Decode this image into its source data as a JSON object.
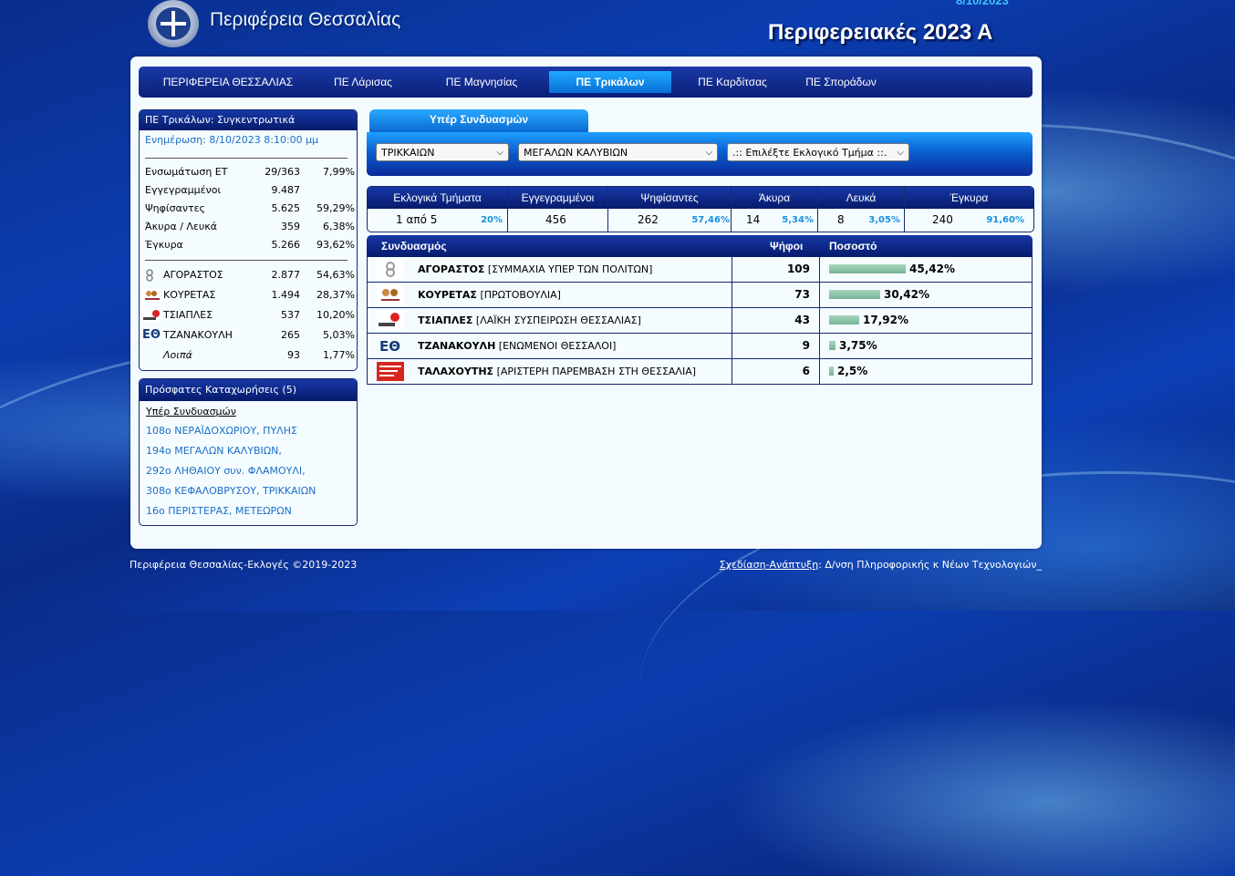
{
  "header": {
    "site_title": "Περιφέρεια Θεσσαλίας",
    "date": "8/10/2023",
    "election_title": "Περιφερειακές 2023 Α"
  },
  "nav": {
    "items": [
      {
        "label": "ΠΕΡΙΦΕΡΕΙΑ ΘΕΣΣΑΛΙΑΣ",
        "active": false
      },
      {
        "label": "ΠΕ Λάρισας",
        "active": false
      },
      {
        "label": "ΠΕ Μαγνησίας",
        "active": false
      },
      {
        "label": "ΠΕ Τρικάλων",
        "active": true
      },
      {
        "label": "ΠΕ Καρδίτσας",
        "active": false
      },
      {
        "label": "ΠΕ Σποράδων",
        "active": false
      }
    ]
  },
  "summary": {
    "title": "ΠΕ Τρικάλων: Συγκεντρωτικά",
    "updated": "Ενημέρωση: 8/10/2023 8:10:00 μμ",
    "rows": [
      {
        "label": "Ενσωμάτωση ΕΤ",
        "value": "29/363",
        "pct": "7,99%"
      },
      {
        "label": "Εγγεγραμμένοι",
        "value": "9.487",
        "pct": ""
      },
      {
        "label": "Ψηφίσαντες",
        "value": "5.625",
        "pct": "59,29%"
      },
      {
        "label": "Άκυρα / Λευκά",
        "value": "359",
        "pct": "6,38%"
      },
      {
        "label": "Έγκυρα",
        "value": "5.266",
        "pct": "93,62%"
      }
    ],
    "candidates": [
      {
        "name": "ΑΓΟΡΑΣΤΟΣ",
        "votes": "2.877",
        "pct": "54,63%",
        "logo": "agorastos-logo"
      },
      {
        "name": "ΚΟΥΡΕΤΑΣ",
        "votes": "1.494",
        "pct": "28,37%",
        "logo": "kouretas-logo"
      },
      {
        "name": "ΤΣΙΑΠΛΕΣ",
        "votes": "537",
        "pct": "10,20%",
        "logo": "tsiaples-logo"
      },
      {
        "name": "ΤΖΑΝΑΚΟΥΛΗ",
        "votes": "265",
        "pct": "5,03%",
        "logo": "eth-logo"
      },
      {
        "name": "Λοιπά",
        "votes": "93",
        "pct": "1,77%",
        "logo": ""
      }
    ]
  },
  "recent": {
    "title": "Πρόσφατες Καταχωρήσεις (5)",
    "subtitle": "Υπέρ Συνδυασμών",
    "items": [
      "108ο ΝΕΡΑΪΔΟΧΩΡΙΟΥ, ΠΥΛΗΣ",
      "194ο ΜΕΓΑΛΩΝ ΚΑΛΥΒΙΩΝ,",
      "292ο ΛΗΘΑΙΟΥ συν. ΦΛΑΜΟΥΛΙ,",
      "308ο ΚΕΦΑΛΟΒΡΥΣΟΥ, ΤΡΙΚΚΑΙΩΝ",
      "16ο ΠΕΡΙΣΤΕΡΑΣ, ΜΕΤΕΩΡΩΝ"
    ]
  },
  "tab": {
    "label": "Υπέρ Συνδυασμών"
  },
  "filters": {
    "municipality": "ΤΡΙΚΚΑΙΩΝ",
    "unit": "ΜΕΓΑΛΩΝ ΚΑΛΥΒΙΩΝ",
    "section": ".:: Επιλέξτε Εκλογικό Τμήμα ::."
  },
  "stats": {
    "headers": [
      "Εκλογικά Τμήματα",
      "Εγγεγραμμένοι",
      "Ψηφίσαντες",
      "Άκυρα",
      "Λευκά",
      "Έγκυρα"
    ],
    "values": [
      {
        "value": "1 από 5",
        "pct": "20%"
      },
      {
        "value": "456",
        "pct": ""
      },
      {
        "value": "262",
        "pct": "57,46%"
      },
      {
        "value": "14",
        "pct": "5,34%"
      },
      {
        "value": "8",
        "pct": "3,05%"
      },
      {
        "value": "240",
        "pct": "91,60%"
      }
    ]
  },
  "results": {
    "headers": {
      "party": "Συνδυασμός",
      "votes": "Ψήφοι",
      "pct": "Ποσοστό"
    },
    "rows": [
      {
        "candidate": "ΑΓΟΡΑΣΤΟΣ",
        "party": "[ΣΥΜΜΑΧΙΑ ΥΠΕΡ ΤΩΝ ΠΟΛΙΤΩΝ]",
        "votes": "109",
        "pct": "45,42%",
        "share": 45.42,
        "logo": "agorastos-logo"
      },
      {
        "candidate": "ΚΟΥΡΕΤΑΣ",
        "party": "[ΠΡΩΤΟΒΟΥΛΙΑ]",
        "votes": "73",
        "pct": "30,42%",
        "share": 30.42,
        "logo": "kouretas-logo"
      },
      {
        "candidate": "ΤΣΙΑΠΛΕΣ",
        "party": "[ΛΑΪΚΗ ΣΥΣΠΕΙΡΩΣΗ ΘΕΣΣΑΛΙΑΣ]",
        "votes": "43",
        "pct": "17,92%",
        "share": 17.92,
        "logo": "tsiaples-logo"
      },
      {
        "candidate": "ΤΖΑΝΑΚΟΥΛΗ",
        "party": "[ΕΝΩΜΕΝΟΙ ΘΕΣΣΑΛΟΙ]",
        "votes": "9",
        "pct": "3,75%",
        "share": 3.75,
        "logo": "eth-logo"
      },
      {
        "candidate": "ΤΑΛΑΧΟΥΤΗΣ",
        "party": "[ΑΡΙΣΤΕΡΗ ΠΑΡΕΜΒΑΣΗ ΣΤΗ ΘΕΣΣΑΛΙΑ]",
        "votes": "6",
        "pct": "2,5%",
        "share": 2.5,
        "logo": "talachoutis-logo"
      }
    ]
  },
  "footer": {
    "left": "Περιφέρεια Θεσσαλίας-Εκλογές ©2019-2023",
    "right_link": "Σχεδίαση-Ανάπτυξη",
    "right_text": ": Δ/νση Πληροφορικής κ Νέων Τεχνολογιών_"
  },
  "colors": {
    "nav_dark": "#0a1f77",
    "active_tab": "#1ea8ff",
    "bar": "#8fc6a8",
    "link": "#1a6fc9"
  },
  "logo_text": {
    "eth": "ΕΘ",
    "eth_small": "ΕΘ"
  }
}
